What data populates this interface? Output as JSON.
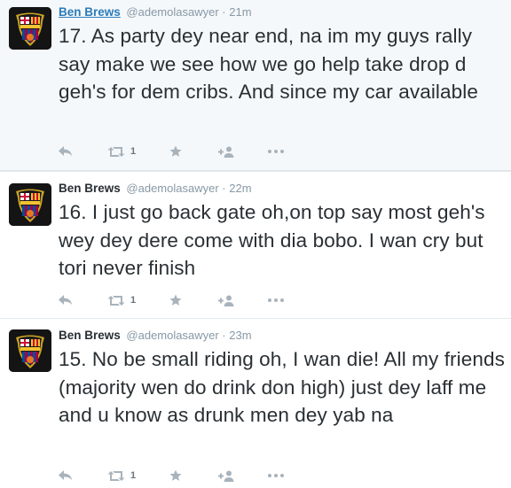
{
  "tweets": [
    {
      "name": "Ben Brews",
      "handle": "@ademolasawyer",
      "separator": "·",
      "time": "21m",
      "text": "17. As party dey near end, na im my guys rally say make we see how we go help take drop d geh's for dem cribs. And since my car available",
      "retweets": "1"
    },
    {
      "name": "Ben Brews",
      "handle": "@ademolasawyer",
      "separator": "·",
      "time": "22m",
      "text": "16. I just go back gate oh,on top say most geh's wey dey dere come with dia bobo. I wan cry but tori never finish",
      "retweets": "1"
    },
    {
      "name": "Ben Brews",
      "handle": "@ademolasawyer",
      "separator": "·",
      "time": "23m",
      "text": "15. No be small riding oh, I wan die! All my friends (majority wen do drink don high) just dey laff me and u know as drunk men dey yab na",
      "retweets": "1"
    }
  ],
  "icons": {
    "reply": "reply-icon",
    "retweet": "retweet-icon",
    "favorite": "star-icon",
    "follow": "follow-icon",
    "more": "more-icon"
  },
  "colors": {
    "highlight_background": "#f5f8fa",
    "name_link": "#2b7bb9",
    "meta_gray": "#8899a6",
    "action_gray": "#a8b3bc",
    "divider": "#e1e8ed"
  }
}
